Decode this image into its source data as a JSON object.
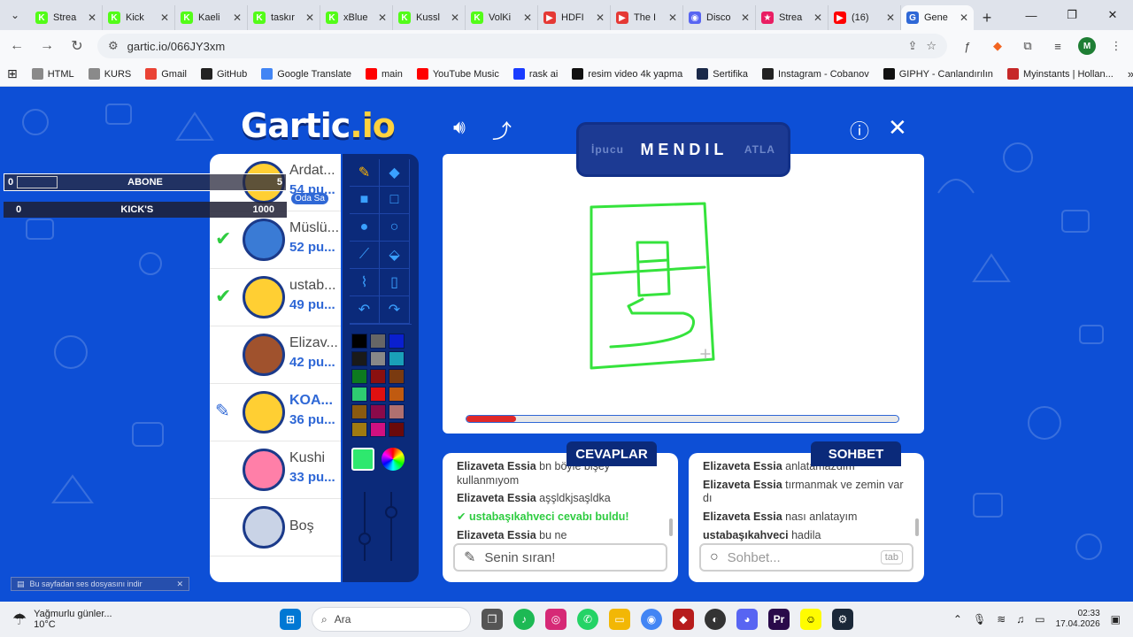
{
  "browser": {
    "tabs": [
      {
        "label": "Strea",
        "color": "#53fc18",
        "glyph": "K"
      },
      {
        "label": "Kick",
        "color": "#53fc18",
        "glyph": "K"
      },
      {
        "label": "Kaeli",
        "color": "#53fc18",
        "glyph": "K"
      },
      {
        "label": "taskır",
        "color": "#53fc18",
        "glyph": "K"
      },
      {
        "label": "xBlue",
        "color": "#53fc18",
        "glyph": "K"
      },
      {
        "label": "Kussl",
        "color": "#53fc18",
        "glyph": "K"
      },
      {
        "label": "VolKi",
        "color": "#53fc18",
        "glyph": "K"
      },
      {
        "label": "HDFI",
        "color": "#e53935",
        "glyph": "▶"
      },
      {
        "label": "The I",
        "color": "#e53935",
        "glyph": "▶"
      },
      {
        "label": "Disco",
        "color": "#5865f2",
        "glyph": "◉"
      },
      {
        "label": "Strea",
        "color": "#e91e63",
        "glyph": "★"
      },
      {
        "label": "(16)",
        "color": "#ff0000",
        "glyph": "▶"
      },
      {
        "label": "Gene",
        "color": "#2f68d6",
        "glyph": "G",
        "active": true
      }
    ],
    "url": "gartic.io/066JY3xm",
    "bookmarks": [
      {
        "label": "HTML",
        "color": "#8a8a8a"
      },
      {
        "label": "KURS",
        "color": "#8a8a8a"
      },
      {
        "label": "Gmail",
        "color": "#ea4335"
      },
      {
        "label": "GitHub",
        "color": "#222222"
      },
      {
        "label": "Google Translate",
        "color": "#4285f4"
      },
      {
        "label": "main",
        "color": "#ff0000"
      },
      {
        "label": "YouTube Music",
        "color": "#ff0000"
      },
      {
        "label": "rask ai",
        "color": "#1a3cff"
      },
      {
        "label": "resim video 4k yapma",
        "color": "#111111"
      },
      {
        "label": "Sertifika",
        "color": "#1b2a4a"
      },
      {
        "label": "Instagram - Cobanov",
        "color": "#222222"
      },
      {
        "label": "GIPHY - Canlandırılın",
        "color": "#111111"
      },
      {
        "label": "Myinstants | Hollan...",
        "color": "#c62828"
      }
    ],
    "profile_initial": "M"
  },
  "game": {
    "logo_main": "Gartic",
    "logo_suffix": ".io",
    "hint_label": "İpucu",
    "word": "MENDIL",
    "skip_label": "ATLA",
    "progress_fraction": 0.115,
    "players": [
      {
        "name": "Ardat...",
        "points": "54 pu...",
        "avatar": "#ffcf33",
        "badge": "Oda Sa",
        "status": ""
      },
      {
        "name": "Müslü...",
        "points": "52 pu...",
        "avatar": "#3a7bd5",
        "status": "check"
      },
      {
        "name": "ustab...",
        "points": "49 pu...",
        "avatar": "#ffcf33",
        "status": "check"
      },
      {
        "name": "Elizav...",
        "points": "42 pu...",
        "avatar": "#a0522d",
        "status": ""
      },
      {
        "name": "KOA...",
        "points": "36 pu...",
        "avatar": "#ffcf33",
        "status": "drawing"
      },
      {
        "name": "Kushi",
        "points": "33 pu...",
        "avatar": "#ff7fa8",
        "status": ""
      },
      {
        "name": "Boş",
        "points": "",
        "avatar": "#c9d3e6",
        "status": "empty"
      }
    ],
    "palette": [
      "#000000",
      "#666666",
      "#0a1fcf",
      "#1a1a1a",
      "#888888",
      "#1aa0b8",
      "#0d7a1f",
      "#8b1010",
      "#7a3a10",
      "#2ecc71",
      "#e01010",
      "#c05a10",
      "#8a5a10",
      "#8a0a4a",
      "#b07070",
      "#a07a10",
      "#d01080",
      "#6a0a0a"
    ],
    "current_color": "#2ee86e",
    "answers_title": "CEVAPLAR",
    "chat_title": "SOHBET",
    "answers": [
      {
        "user": "Elizaveta Essia",
        "text": "bn böyle bişey kullanmıyom",
        "type": "msg"
      },
      {
        "user": "Elizaveta Essia",
        "text": "aşşldkjsaşldka",
        "type": "msg"
      },
      {
        "user": "ustabaşıkahveci",
        "text": "cevabı buldu!",
        "type": "ok"
      },
      {
        "user": "Elizaveta Essia",
        "text": "bu ne",
        "type": "msg"
      }
    ],
    "chat": [
      {
        "user": "Elizaveta Essia",
        "text": "anlatamazdım"
      },
      {
        "user": "Elizaveta Essia",
        "text": "tırmanmak ve zemin var dı"
      },
      {
        "user": "Elizaveta Essia",
        "text": "nası anlatayım"
      },
      {
        "user": "ustabaşıkahveci",
        "text": "hadila"
      }
    ],
    "answer_input_label": "Senin sıran!",
    "chat_placeholder": "Sohbet...",
    "tab_key": "tab"
  },
  "overlay": {
    "row1_left": "0",
    "row1_label": "ABONE",
    "row1_right": "5",
    "row2_left": "0",
    "row2_label": "KICK'S",
    "row2_right": "1000",
    "notice": "Bu sayfadan ses dosyasını indir"
  },
  "taskbar": {
    "weather_title": "Yağmurlu günler...",
    "weather_temp": "10°C",
    "search_label": "Ara",
    "time": "02:33",
    "date": "17.04.2026"
  }
}
